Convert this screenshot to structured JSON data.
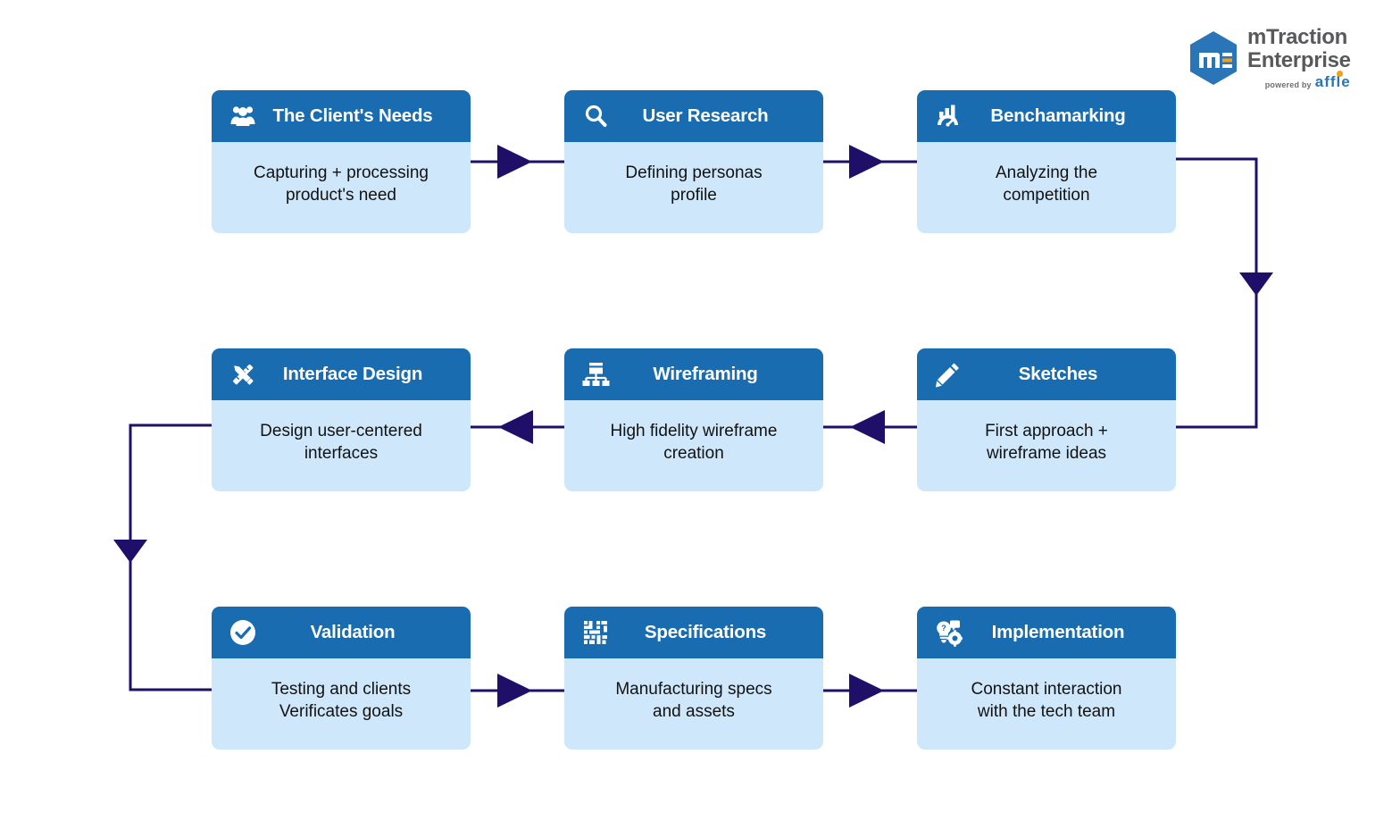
{
  "logo": {
    "name": "mTraction Enterprise",
    "line1": "mTraction",
    "line2": "Enterprise",
    "powered_by": "powered by",
    "affle": "affle",
    "mark_letter": "m",
    "colors": {
      "hex_mark": "#2a74b8",
      "accent_orange": "#f6a01a",
      "wordmark": "#58595b"
    }
  },
  "theme": {
    "header_blue": "#1a6cb0",
    "body_blue": "#cfe7fb",
    "connector_navy": "#1f0f68",
    "page_background": "#ffffff"
  },
  "diagram_data": {
    "type": "flowchart",
    "flow_direction": "serpentine (boustrophedon): row 1 left-to-right, row 2 right-to-left, row 3 left-to-right",
    "rows": 3,
    "columns": 3,
    "steps": [
      {
        "index": 1,
        "title": "The Client's Needs",
        "description": "Capturing + processing\nproduct's need",
        "icon": "users-group-icon",
        "row": 1,
        "column": 1
      },
      {
        "index": 2,
        "title": "User Research",
        "description": "Defining personas\nprofile",
        "icon": "magnifier-search-icon",
        "row": 1,
        "column": 2
      },
      {
        "index": 3,
        "title": "Benchamarking",
        "description": "Analyzing the\ncompetition",
        "icon": "bar-chart-gauge-icon",
        "row": 1,
        "column": 3
      },
      {
        "index": 4,
        "title": "Sketches",
        "description": "First approach +\nwireframe ideas",
        "icon": "pencil-icon",
        "row": 2,
        "column": 3
      },
      {
        "index": 5,
        "title": "Wireframing",
        "description": "High fidelity wireframe\ncreation",
        "icon": "sitemap-hierarchy-icon",
        "row": 2,
        "column": 2
      },
      {
        "index": 6,
        "title": "Interface Design",
        "description": "Design user-centered\ninterfaces",
        "icon": "ruler-pencil-icon",
        "row": 2,
        "column": 1
      },
      {
        "index": 7,
        "title": "Validation",
        "description": "Testing and clients\nVerificates goals",
        "icon": "check-circle-icon",
        "row": 3,
        "column": 1
      },
      {
        "index": 8,
        "title": "Specifications",
        "description": "Manufacturing specs\nand assets",
        "icon": "qr-blocks-icon",
        "row": 3,
        "column": 2
      },
      {
        "index": 9,
        "title": "Implementation",
        "description": "Constant interaction\nwith the tech team",
        "icon": "lightbulb-gear-icon",
        "row": 3,
        "column": 3
      }
    ],
    "connectors": [
      {
        "from": 1,
        "to": 2,
        "style": "straight-right-arrow"
      },
      {
        "from": 2,
        "to": 3,
        "style": "straight-right-arrow"
      },
      {
        "from": 3,
        "to": 4,
        "style": "elbow-right-down-left-arrow"
      },
      {
        "from": 4,
        "to": 5,
        "style": "straight-left-arrow"
      },
      {
        "from": 5,
        "to": 6,
        "style": "straight-left-arrow"
      },
      {
        "from": 6,
        "to": 7,
        "style": "elbow-left-down-right-arrow"
      },
      {
        "from": 7,
        "to": 8,
        "style": "straight-right-arrow"
      },
      {
        "from": 8,
        "to": 9,
        "style": "straight-right-arrow"
      }
    ]
  }
}
